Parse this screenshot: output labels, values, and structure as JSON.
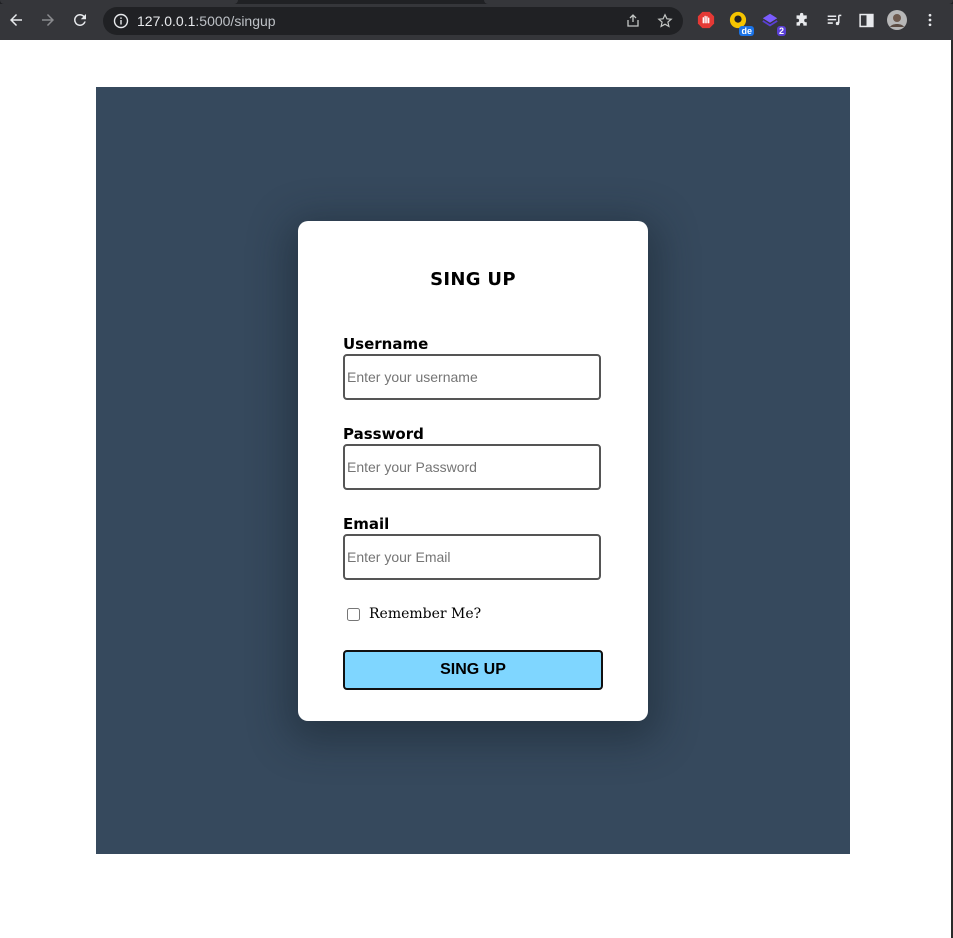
{
  "browser": {
    "url_host": "127.0.0.1",
    "url_path": ":5000/singup",
    "extensions": [
      {
        "name": "adblock-icon",
        "color": "#e53935"
      },
      {
        "name": "translate-extension-icon",
        "color": "#f5c400",
        "badge": "de",
        "badge_color": "#1a73e8"
      },
      {
        "name": "stack-extension-icon",
        "color": "#5a3fd6",
        "badge": "2",
        "badge_color": "#5a3fd6"
      }
    ]
  },
  "form": {
    "title": "SING UP",
    "fields": [
      {
        "label": "Username",
        "placeholder": "Enter your username",
        "value": ""
      },
      {
        "label": "Password",
        "placeholder": "Enter your Password",
        "value": ""
      },
      {
        "label": "Email",
        "placeholder": "Enter your Email",
        "value": ""
      }
    ],
    "remember_label": "Remember Me?",
    "remember_checked": false,
    "submit_label": "SING UP"
  },
  "colors": {
    "panel_bg": "#36495d",
    "button_bg": "#7fd6ff"
  }
}
